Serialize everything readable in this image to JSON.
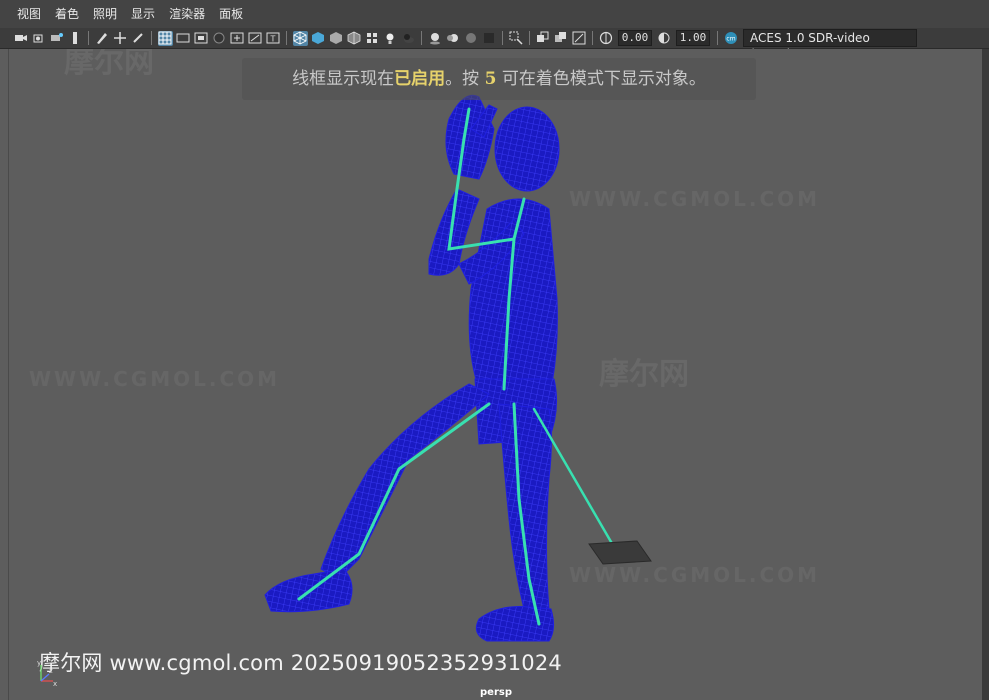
{
  "menu": [
    "视图",
    "着色",
    "照明",
    "显示",
    "渲染器",
    "面板"
  ],
  "toolbar": {
    "exposure": "0.00",
    "gamma": "1.00",
    "color_space": "ACES 1.0 SDR-video (sRGB)"
  },
  "viewport": {
    "banner_prefix": "线框显示现在",
    "banner_highlight": "已启用",
    "banner_mid": "。按 ",
    "banner_key": "5",
    "banner_suffix": " 可在着色模式下显示对象。",
    "camera": "persp",
    "credit": "摩尔网 www.cgmol.com 20250919052352931024",
    "watermark_cn": "摩尔网",
    "watermark_en": "WWW.CGMOL.COM",
    "axis_y": "y",
    "axis_x": "x",
    "axis_z": "z"
  },
  "colors": {
    "wire": "#1414c8",
    "skeleton": "#38e0b0",
    "bg": "#5d5d5d"
  }
}
